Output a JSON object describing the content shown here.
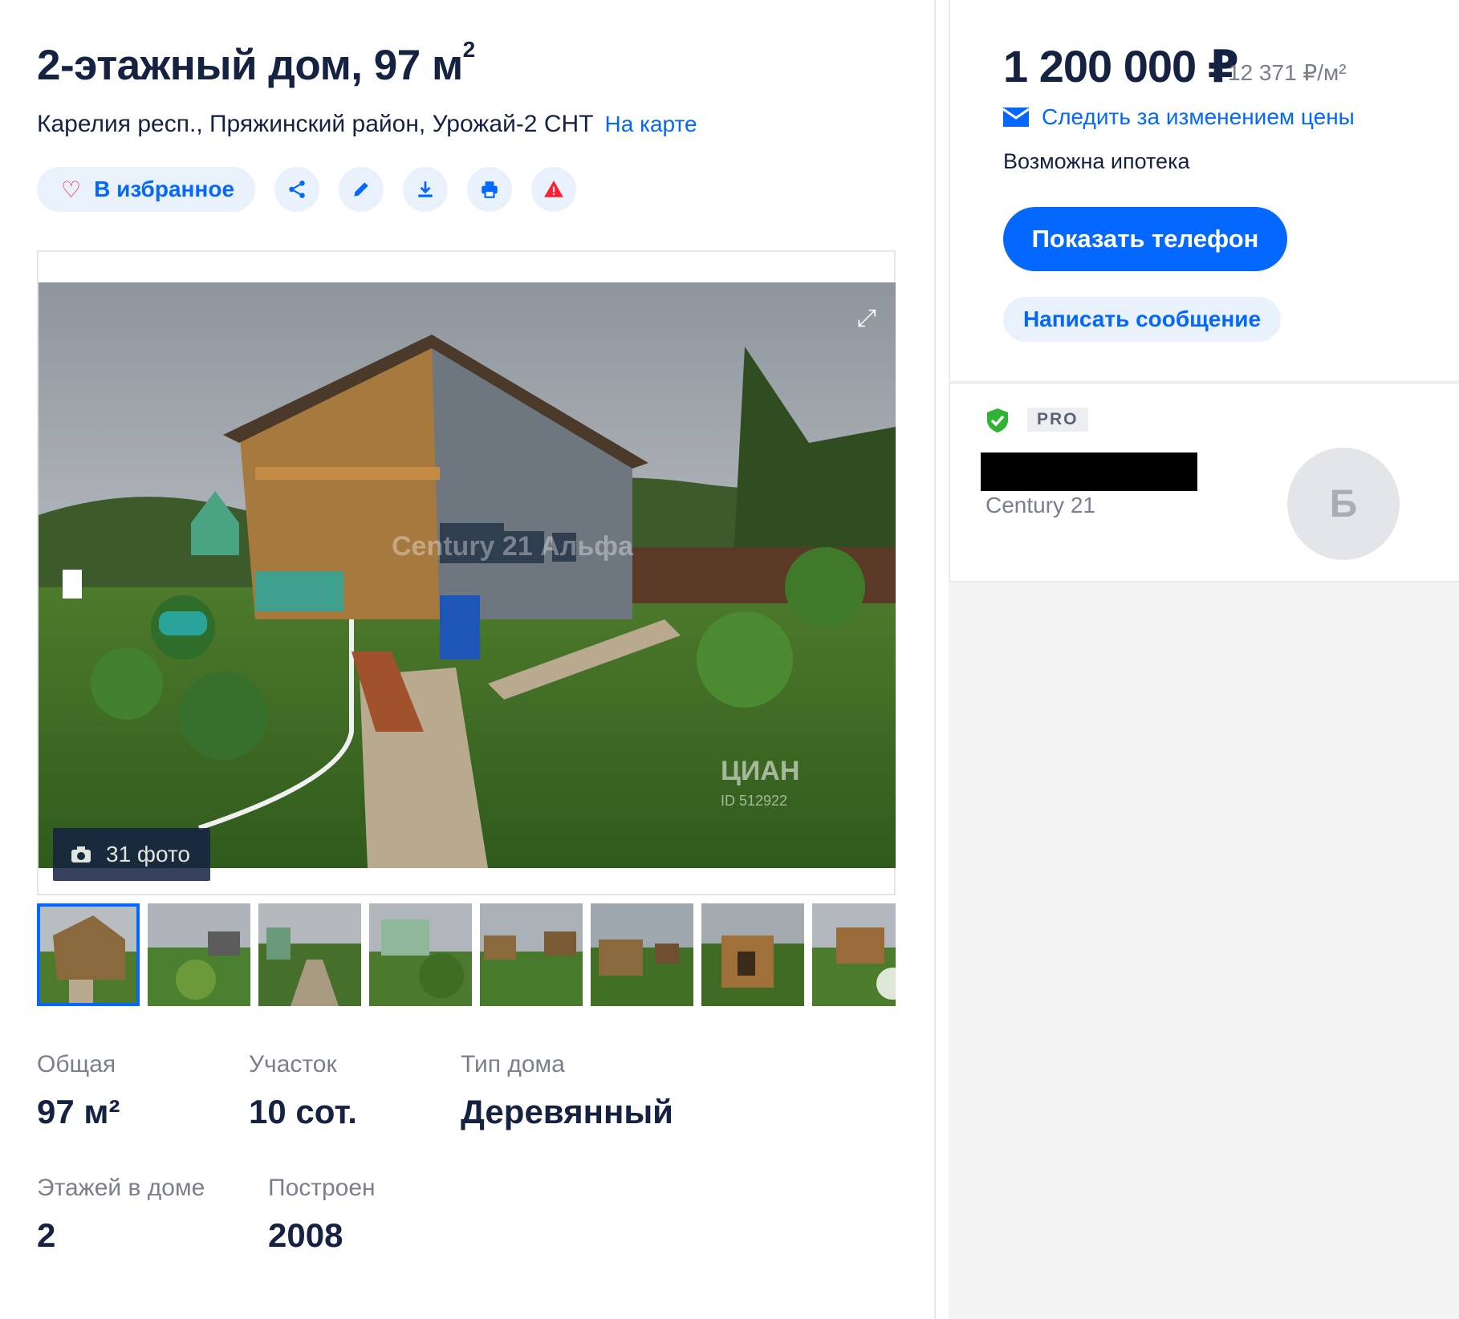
{
  "listing": {
    "title": "2-этажный дом, 97 м",
    "title_sup": "2",
    "address": "Карелия респ., Пряжинский район, Урожай-2 СНТ",
    "map_link": "На карте"
  },
  "actions": {
    "favorite_label": "В избранное",
    "icons": [
      "share-icon",
      "edit-icon",
      "download-icon",
      "print-icon",
      "report-icon"
    ]
  },
  "gallery": {
    "photo_count": "31 фото",
    "thumbnail_count": 8,
    "active_thumbnail": 1,
    "watermark_agency": "Century 21 Альфа",
    "watermark_site": "ЦИАН",
    "watermark_id": "ID 512922"
  },
  "params": [
    {
      "label": "Общая",
      "value": "97 м²"
    },
    {
      "label": "Участок",
      "value": "10 сот."
    },
    {
      "label": "Тип дома",
      "value": "Деревянный"
    },
    {
      "label": "Этажей в доме",
      "value": "2"
    },
    {
      "label": "Построен",
      "value": "2008"
    }
  ],
  "sidebar": {
    "price": "1 200 000 ₽",
    "price_per_m": "12 371 ₽/м²",
    "follow_price": "Следить за изменением цены",
    "mortgage": "Возможна ипотека",
    "show_phone": "Показать телефон",
    "write_message": "Написать сообщение"
  },
  "agent": {
    "badge": "PRO",
    "agency": "Century 21",
    "avatar_letter": "Б"
  },
  "colors": {
    "accent": "#0468ff",
    "text": "#152242",
    "muted": "#7a7f8d",
    "heart": "#ff1f34",
    "verified": "#2fb335"
  }
}
